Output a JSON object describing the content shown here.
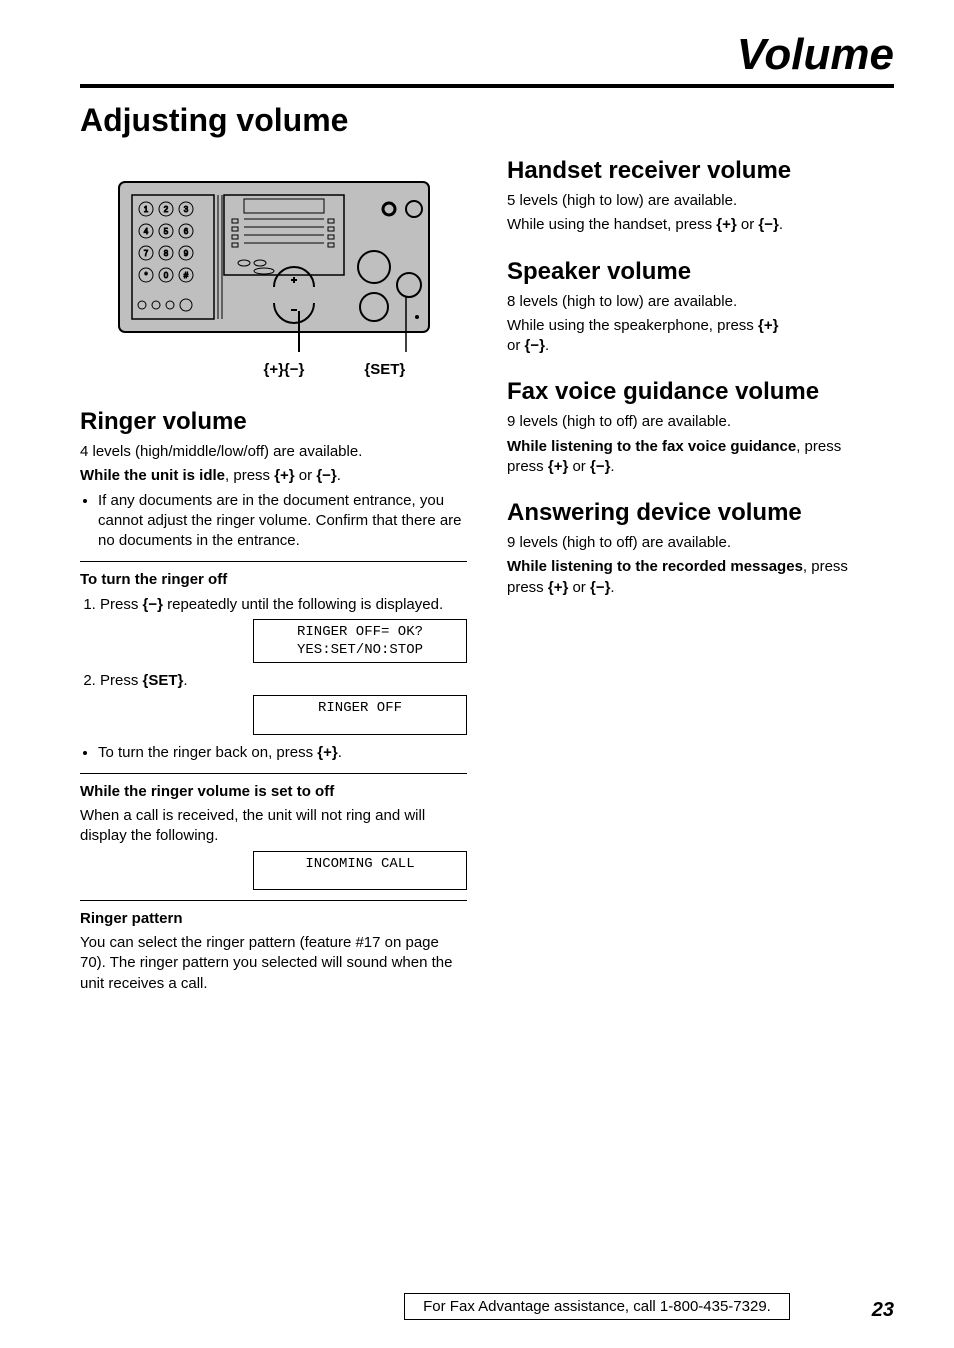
{
  "top_title": "Volume",
  "main_heading": "Adjusting volume",
  "device_labels": {
    "plus_minus": "{+}{−}",
    "set": "{SET}"
  },
  "left": {
    "ringer": {
      "heading": "Ringer volume",
      "line1": "4 levels (high/middle/low/off) are available.",
      "line2_pre": "While the unit is idle",
      "line2_post": ", press ",
      "bullet": "If any documents are in the document entrance, you cannot adjust the ringer volume. Confirm that there are no documents in the entrance.",
      "off": {
        "heading": "To turn the ringer off",
        "step1_pre": "Press ",
        "step1_post": " repeatedly until the following is displayed.",
        "display1_line1": "RINGER OFF= OK?",
        "display1_line2": "YES:SET/NO:STOP",
        "step2_pre": "Press ",
        "step2_key": "{SET}",
        "step2_post": ".",
        "display2": "RINGER OFF",
        "back_on_pre": "To turn the ringer back on, press ",
        "back_on_post": "."
      },
      "while_off": {
        "heading": "While the ringer volume is set to off",
        "para": "When a call is received, the unit will not ring and will display the following.",
        "display": "INCOMING CALL"
      },
      "pattern": {
        "heading": "Ringer pattern",
        "para": "You can select the ringer pattern (feature #17 on page 70). The ringer pattern you selected will sound when the unit receives a call."
      }
    }
  },
  "right": {
    "handset": {
      "heading": "Handset receiver volume",
      "line1": "5 levels (high to low) are available.",
      "line2_pre": "While using the handset, press ",
      "line2_post": "."
    },
    "speaker": {
      "heading": "Speaker volume",
      "line1": "8 levels (high to low) are available.",
      "line2a": "While using the speakerphone, press ",
      "line2b": "or ",
      "line2c": "."
    },
    "fax": {
      "heading": "Fax voice guidance volume",
      "line1": "9 levels (high to off) are available.",
      "line2_bold": "While listening to the fax voice guidance",
      "line2_post": ", press ",
      "line2_end": "."
    },
    "ans": {
      "heading": "Answering device volume",
      "line1": "9 levels (high to off) are available.",
      "line2_bold": "While listening to the recorded messages",
      "line2_post": ", press ",
      "line2_end": "."
    }
  },
  "keys": {
    "plus": "{+}",
    "minus": "{−}",
    "set": "{SET}"
  },
  "footer": {
    "text": "For Fax Advantage assistance, call 1-800-435-7329.",
    "page": "23"
  }
}
